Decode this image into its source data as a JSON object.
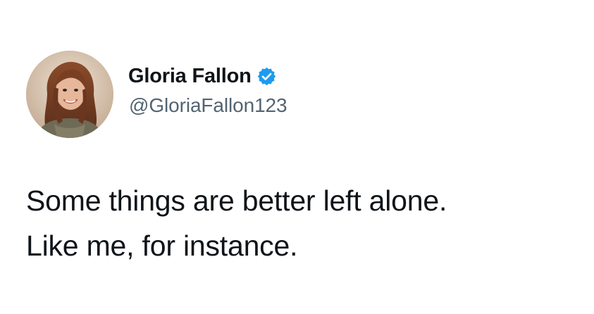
{
  "tweet": {
    "author": {
      "display_name": "Gloria Fallon",
      "handle": "@GloriaFallon123",
      "verified": true,
      "avatar_icon": "profile-photo"
    },
    "text_lines": [
      "Some things are better left alone.",
      "Like me, for instance."
    ]
  },
  "colors": {
    "background": "#ffffff",
    "name": "#0f1419",
    "handle": "#536471",
    "verified_badge": "#1d9bf0"
  }
}
